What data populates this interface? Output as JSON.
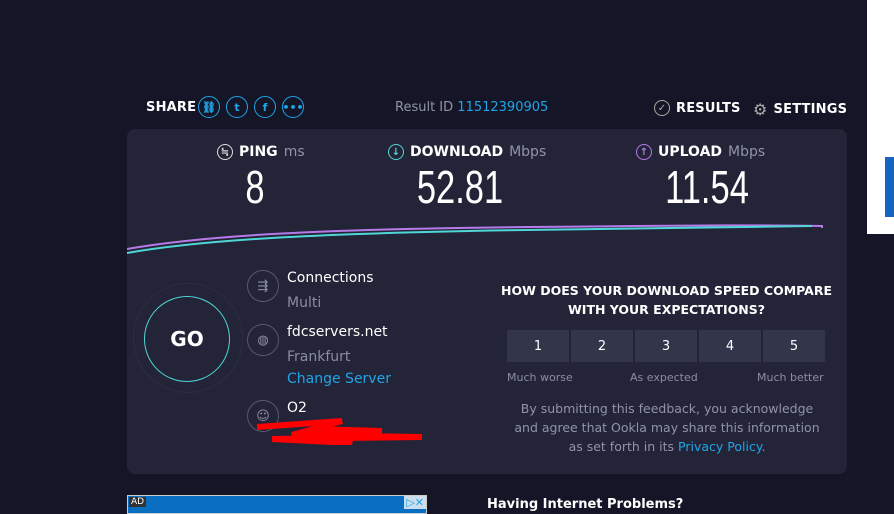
{
  "header": {
    "share_label": "SHARE",
    "share_icons": [
      "link-icon",
      "twitter-icon",
      "facebook-icon",
      "more-icon"
    ],
    "result_id_label": "Result ID",
    "result_id": "11512390905",
    "results_label": "RESULTS",
    "settings_label": "SETTINGS"
  },
  "metrics": {
    "ping": {
      "label": "PING",
      "unit": "ms",
      "value": "8"
    },
    "download": {
      "label": "DOWNLOAD",
      "unit": "Mbps",
      "value": "52.81"
    },
    "upload": {
      "label": "UPLOAD",
      "unit": "Mbps",
      "value": "11.54"
    }
  },
  "go_label": "GO",
  "connections": {
    "title": "Connections",
    "value": "Multi"
  },
  "server": {
    "host": "fdcservers.net",
    "city": "Frankfurt",
    "change_label": "Change Server"
  },
  "isp": {
    "name": "O2"
  },
  "feedback": {
    "question": "HOW DOES YOUR DOWNLOAD SPEED COMPARE WITH YOUR EXPECTATIONS?",
    "options": [
      "1",
      "2",
      "3",
      "4",
      "5"
    ],
    "low": "Much worse",
    "mid": "As expected",
    "high": "Much better",
    "disclaimer": "By submitting this feedback, you acknowledge and agree that Ookla may share this information as set forth in its",
    "privacy_link": "Privacy Policy"
  },
  "ad": {
    "label": "AD"
  },
  "help_title": "Having Internet Problems?",
  "colors": {
    "accent": "#1fa5e8",
    "download": "#4fd6d6",
    "upload": "#b67be8"
  }
}
